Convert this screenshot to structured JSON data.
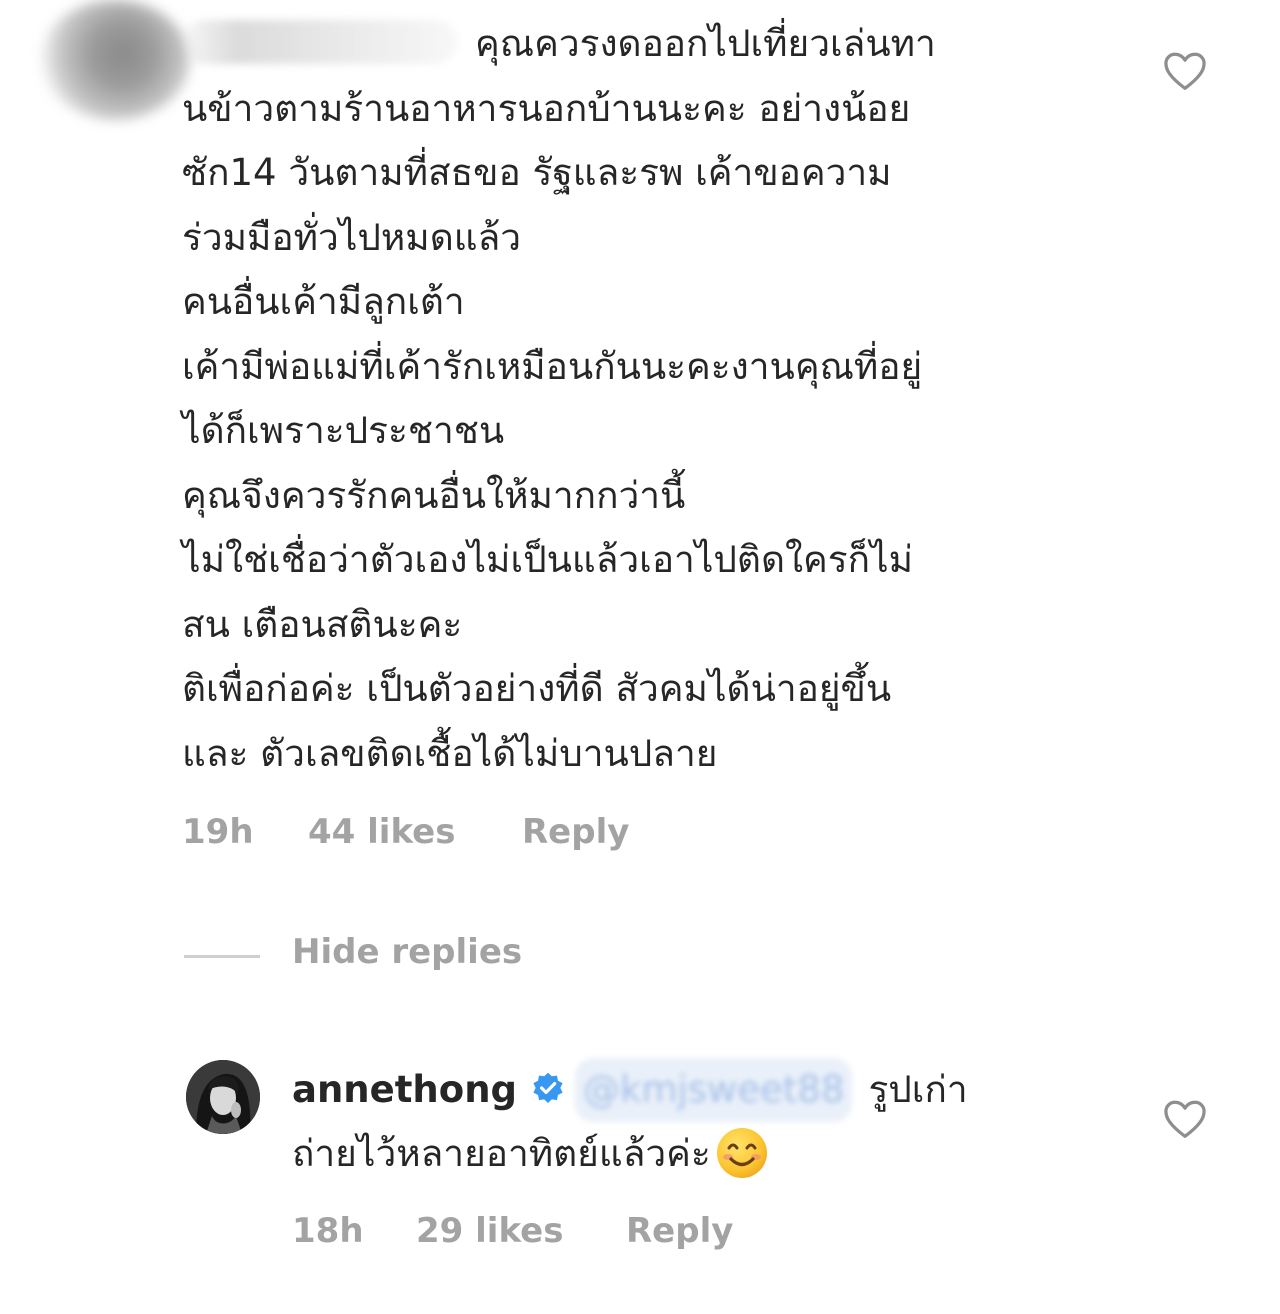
{
  "comment": {
    "lines": [
      "คุณควรงดออกไปเที่ยวเล่นทา",
      "นข้าวตามร้านอาหารนอกบ้านนะคะ อย่างน้อย",
      "ซัก14 วันตามที่สธขอ รัฐและรพ เค้าขอความ",
      "ร่วมมือทั่วไปหมดแล้ว",
      "คนอื่นเค้ามีลูกเต้า",
      "เค้ามีพ่อแม่ที่เค้ารักเหมือนกันนะคะงานคุณที่อยู่",
      "ได้ก็เพราะประชาชน",
      "คุณจึงควรรักคนอื่นให้มากกว่านี้",
      "ไม่ใช่เชื่อว่าตัวเองไม่เป็นแล้วเอาไปติดใครก็ไม่",
      "สน เตือนสตินะคะ",
      "ติเพื่อก่อค่ะ เป็นตัวอย่างที่ดี สัวคมได้น่าอยู่ขึ้น",
      "และ ตัวเลขติดเชื้อได้ไม่บานปลาย"
    ],
    "time": "19h",
    "likes": "44 likes",
    "reply_label": "Reply",
    "like_icon": "heart-outline-icon"
  },
  "hide_replies_label": "Hide replies",
  "reply": {
    "username": "annethong",
    "verified_icon": "verified-badge-icon",
    "mention": "@kmjsweet88",
    "line1_text": "รูปเก่า",
    "line2_text": "ถ่ายไว้หลายอาทิตย์แล้วค่ะ",
    "emoji": "smiling-face-emoji",
    "time": "18h",
    "likes": "29 likes",
    "reply_label": "Reply",
    "like_icon": "heart-outline-icon"
  },
  "colors": {
    "text": "#262626",
    "meta": "#a3a3a3",
    "verified": "#3897f0",
    "divider": "#cfcfcf"
  }
}
